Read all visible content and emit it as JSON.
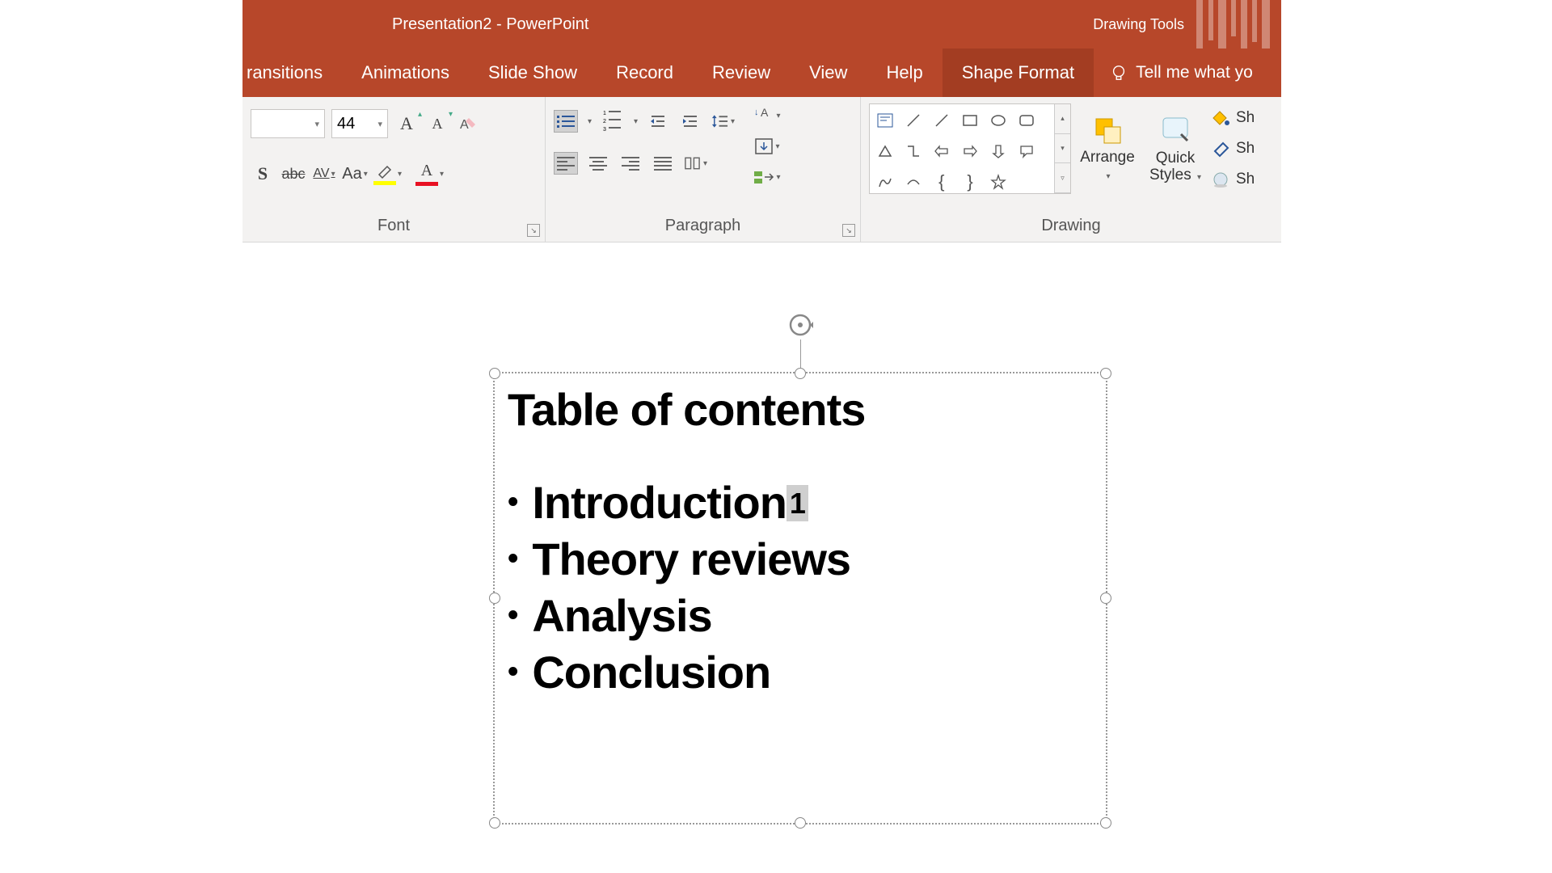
{
  "titlebar": {
    "title": "Presentation2  -  PowerPoint",
    "context_tool": "Drawing Tools"
  },
  "menu": {
    "transitions": "ransitions",
    "animations": "Animations",
    "slideshow": "Slide Show",
    "record": "Record",
    "review": "Review",
    "view": "View",
    "help": "Help",
    "shapeformat": "Shape Format",
    "tellme": "Tell me what yo"
  },
  "ribbon": {
    "font": {
      "size": "44",
      "group_label": "Font"
    },
    "paragraph": {
      "group_label": "Paragraph"
    },
    "drawing": {
      "group_label": "Drawing",
      "arrange": "Arrange",
      "quick_styles": "Quick\nStyles",
      "shapefill": "Sh",
      "shapeoutline": "Sh",
      "shapeeffects": "Sh"
    }
  },
  "slide": {
    "title": "Table of contents",
    "items": [
      "Introduction",
      "Theory reviews",
      "Analysis",
      "Conclusion"
    ],
    "superscript_on_first": "1"
  }
}
